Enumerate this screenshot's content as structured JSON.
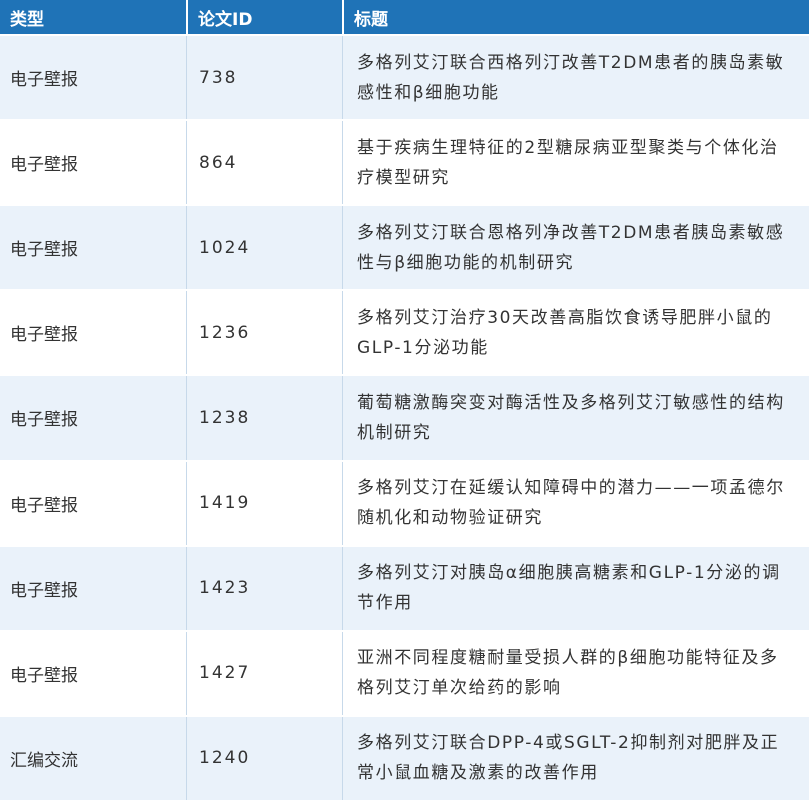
{
  "table": {
    "headers": {
      "type": "类型",
      "paper_id": "论文ID",
      "title": "标题"
    },
    "rows": [
      {
        "type": "电子壁报",
        "id": "738",
        "title": "多格列艾汀联合西格列汀改善T2DM患者的胰岛素敏感性和β细胞功能"
      },
      {
        "type": "电子壁报",
        "id": "864",
        "title": "基于疾病生理特征的2型糖尿病亚型聚类与个体化治疗模型研究"
      },
      {
        "type": "电子壁报",
        "id": "1024",
        "title": "多格列艾汀联合恩格列净改善T2DM患者胰岛素敏感性与β细胞功能的机制研究"
      },
      {
        "type": "电子壁报",
        "id": "1236",
        "title": "多格列艾汀治疗30天改善高脂饮食诱导肥胖小鼠的GLP-1分泌功能"
      },
      {
        "type": "电子壁报",
        "id": "1238",
        "title": "葡萄糖激酶突变对酶活性及多格列艾汀敏感性的结构机制研究"
      },
      {
        "type": "电子壁报",
        "id": "1419",
        "title": "多格列艾汀在延缓认知障碍中的潜力——一项孟德尔随机化和动物验证研究"
      },
      {
        "type": "电子壁报",
        "id": "1423",
        "title": "多格列艾汀对胰岛α细胞胰高糖素和GLP-1分泌的调节作用"
      },
      {
        "type": "电子壁报",
        "id": "1427",
        "title": "亚洲不同程度糖耐量受损人群的β细胞功能特征及多格列艾汀单次给药的影响"
      },
      {
        "type": "汇编交流",
        "id": "1240",
        "title": "多格列艾汀联合DPP-4或SGLT-2抑制剂对肥胖及正常小鼠血糖及激素的改善作用"
      }
    ]
  }
}
